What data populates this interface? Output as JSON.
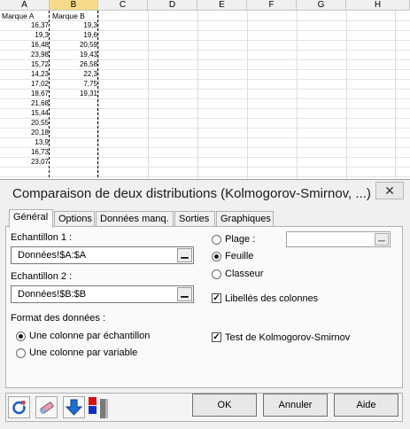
{
  "sheet": {
    "columns": [
      "A",
      "B",
      "C",
      "D",
      "E",
      "F",
      "G",
      "H"
    ],
    "header_a": "Marque A",
    "header_b": "Marque B",
    "col_a": [
      "16,37",
      "19,3",
      "16,48",
      "23,98",
      "15,72",
      "14,23",
      "17,02",
      "18,67",
      "21,68",
      "15,44",
      "20,55",
      "20,18",
      "13,9",
      "16,73",
      "23,07"
    ],
    "col_b": [
      "19,3",
      "19,6",
      "20,59",
      "19,43",
      "26,58",
      "22,3",
      "7,75",
      "19,31"
    ]
  },
  "dialog": {
    "title": "Comparaison de deux distributions (Kolmogorov-Smirnov, ...)",
    "close_icon": "close-icon",
    "tabs": [
      "Général",
      "Options",
      "Données manq.",
      "Sorties",
      "Graphiques"
    ],
    "sample1_label": "Echantillon 1 :",
    "sample1_value": "Données!$A:$A",
    "sample2_label": "Echantillon 2 :",
    "sample2_value": "Données!$B:$B",
    "format_label": "Format des données :",
    "format_opt1": "Une colonne par échantillon",
    "format_opt2": "Une colonne par variable",
    "plage_label": "Plage :",
    "feuille_label": "Feuille",
    "classeur_label": "Classeur",
    "libelles_label": "Libellés des colonnes",
    "ks_label": "Test de Kolmogorov-Smirnov",
    "ok_label": "OK",
    "annuler_label": "Annuler",
    "aide_label": "Aide",
    "icons": [
      "reset-icon",
      "eraser-icon",
      "down-arrow-icon",
      "xlstat-colors-icon"
    ]
  }
}
